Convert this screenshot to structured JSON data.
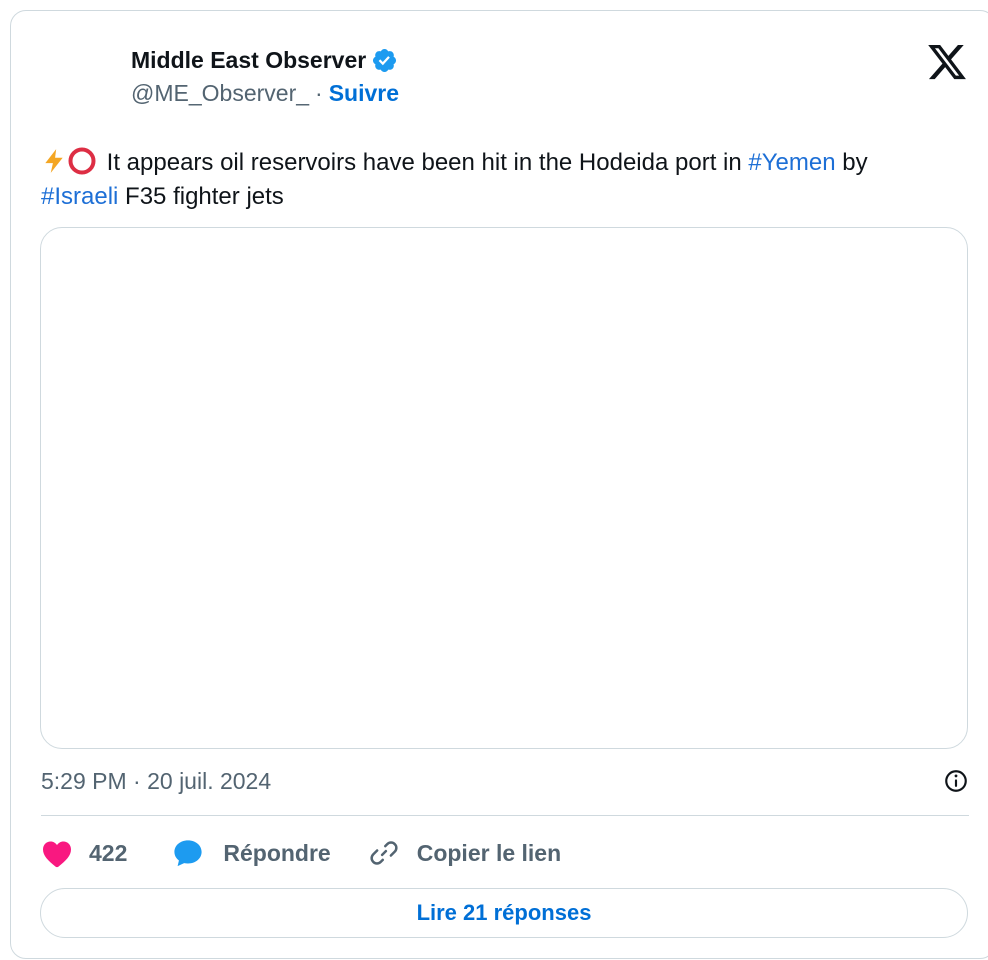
{
  "author": {
    "display_name": "Middle East Observer",
    "handle": "@ME_Observer_",
    "separator": "·",
    "follow_label": "Suivre"
  },
  "tweet": {
    "text_before_tag1": " It appears oil reservoirs have been hit in the Hodeida port in ",
    "hashtag1": "#Yemen",
    "text_between": " by",
    "hashtag2": "#Israeli",
    "text_after": " F35 fighter jets",
    "emojis": [
      "high-voltage-emoji",
      "red-circle-emoji"
    ]
  },
  "meta": {
    "timestamp": "5:29 PM · 20 juil. 2024"
  },
  "actions": {
    "like_count": "422",
    "reply_label": "Répondre",
    "copy_link_label": "Copier le lien"
  },
  "read_replies_label": "Lire 21 réponses",
  "colors": {
    "link_blue": "#006fd6",
    "verified_blue": "#1d9bf0",
    "heart_pink": "#f91880",
    "text_dark": "#0f1419",
    "text_gray": "#536471",
    "border": "#cfd9de"
  }
}
